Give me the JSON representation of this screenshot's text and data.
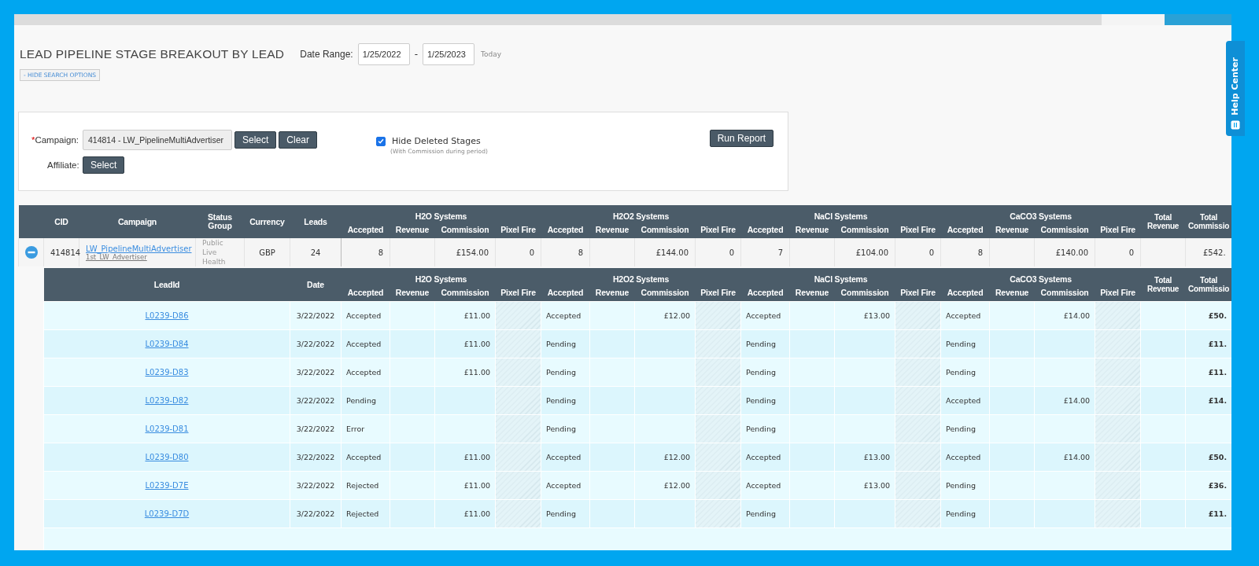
{
  "report": {
    "title": "LEAD PIPELINE STAGE BREAKOUT BY LEAD",
    "date_range_label": "Date Range:",
    "date_from": "1/25/2022",
    "separator": "-",
    "date_to": "1/25/2023",
    "today_link": "Today",
    "toggle_button": "- HIDE SEARCH OPTIONS"
  },
  "search": {
    "required_mark": "*",
    "campaign_label": "Campaign:",
    "campaign_value": "414814 - LW_PipelineMultiAdvertiser",
    "select_button": "Select",
    "clear_button": "Clear",
    "affiliate_label": "Affiliate:",
    "affiliate_select_button": "Select",
    "hide_deleted": {
      "label": "Hide Deleted Stages",
      "checked": true,
      "note": "(With Commission during period)"
    },
    "run_button": "Run Report"
  },
  "table": {
    "columns": [
      "CID",
      "Campaign",
      "Status Group",
      "Currency",
      "Leads"
    ],
    "systems": [
      {
        "name": "H2O Systems",
        "columns": [
          "Accepted",
          "Revenue",
          "Commission",
          "Pixel Fire"
        ]
      },
      {
        "name": "H2O2 Systems",
        "columns": [
          "Accepted",
          "Revenue",
          "Commission",
          "Pixel Fire"
        ]
      },
      {
        "name": "NaCl Systems",
        "columns": [
          "Accepted",
          "Revenue",
          "Commission",
          "Pixel Fire"
        ]
      },
      {
        "name": "CaCO3 Systems",
        "columns": [
          "Accepted",
          "Revenue",
          "Commission",
          "Pixel Fire"
        ]
      }
    ],
    "total_columns": [
      "Total Revenue",
      "Total Commissio"
    ],
    "rows": [
      {
        "expanded": true,
        "cid": "414814",
        "campaign": "LW_PipelineMultiAdvertiser",
        "advertiser": "1st_LW_Advertiser",
        "status_group": "Public Live Health",
        "currency": "GBP",
        "leads": "24",
        "systems": [
          {
            "accepted": "8",
            "commission": "£154.00",
            "pixel_fire": "0"
          },
          {
            "accepted": "8",
            "commission": "£144.00",
            "pixel_fire": "0"
          },
          {
            "accepted": "7",
            "commission": "£104.00",
            "pixel_fire": "0"
          },
          {
            "accepted": "8",
            "commission": "£140.00",
            "pixel_fire": "0"
          }
        ],
        "total_commission": "£542."
      }
    ]
  },
  "leads_table": {
    "columns": [
      "LeadId",
      "Date"
    ],
    "systems": [
      {
        "name": "H2O Systems",
        "columns": [
          "Accepted",
          "Revenue",
          "Commission",
          "Pixel Fire"
        ]
      },
      {
        "name": "H2O2 Systems",
        "columns": [
          "Accepted",
          "Revenue",
          "Commission",
          "Pixel Fire"
        ]
      },
      {
        "name": "NaCl Systems",
        "columns": [
          "Accepted",
          "Revenue",
          "Commission",
          "Pixel Fire"
        ]
      },
      {
        "name": "CaCO3 Systems",
        "columns": [
          "Accepted",
          "Revenue",
          "Commission",
          "Pixel Fire"
        ]
      }
    ],
    "total_columns": [
      "Total Revenue",
      "Total Commissio"
    ],
    "rows": [
      {
        "lead_id": "L0239-D86",
        "date": "3/22/2022",
        "systems": [
          {
            "status": "Accepted",
            "commission": "£11.00"
          },
          {
            "status": "Accepted",
            "commission": "£12.00"
          },
          {
            "status": "Accepted",
            "commission": "£13.00"
          },
          {
            "status": "Accepted",
            "commission": "£14.00"
          }
        ],
        "total_commission": "£50."
      },
      {
        "lead_id": "L0239-D84",
        "date": "3/22/2022",
        "systems": [
          {
            "status": "Accepted",
            "commission": "£11.00"
          },
          {
            "status": "Pending"
          },
          {
            "status": "Pending"
          },
          {
            "status": "Pending"
          }
        ],
        "total_commission": "£11."
      },
      {
        "lead_id": "L0239-D83",
        "date": "3/22/2022",
        "systems": [
          {
            "status": "Accepted",
            "commission": "£11.00"
          },
          {
            "status": "Pending"
          },
          {
            "status": "Pending"
          },
          {
            "status": "Pending"
          }
        ],
        "total_commission": "£11."
      },
      {
        "lead_id": "L0239-D82",
        "date": "3/22/2022",
        "systems": [
          {
            "status": "Pending"
          },
          {
            "status": "Pending"
          },
          {
            "status": "Pending"
          },
          {
            "status": "Accepted",
            "commission": "£14.00"
          }
        ],
        "total_commission": "£14."
      },
      {
        "lead_id": "L0239-D81",
        "date": "3/22/2022",
        "systems": [
          {
            "status": "Error"
          },
          {
            "status": "Pending"
          },
          {
            "status": "Pending"
          },
          {
            "status": "Pending"
          }
        ]
      },
      {
        "lead_id": "L0239-D80",
        "date": "3/22/2022",
        "systems": [
          {
            "status": "Accepted",
            "commission": "£11.00"
          },
          {
            "status": "Accepted",
            "commission": "£12.00"
          },
          {
            "status": "Accepted",
            "commission": "£13.00"
          },
          {
            "status": "Accepted",
            "commission": "£14.00"
          }
        ],
        "total_commission": "£50."
      },
      {
        "lead_id": "L0239-D7E",
        "date": "3/22/2022",
        "systems": [
          {
            "status": "Rejected",
            "commission": "£11.00"
          },
          {
            "status": "Accepted",
            "commission": "£12.00"
          },
          {
            "status": "Accepted",
            "commission": "£13.00"
          },
          {
            "status": "Pending"
          }
        ],
        "total_commission": "£36."
      },
      {
        "lead_id": "L0239-D7D",
        "date": "3/22/2022",
        "systems": [
          {
            "status": "Rejected",
            "commission": "£11.00"
          },
          {
            "status": "Pending"
          },
          {
            "status": "Pending"
          },
          {
            "status": "Pending"
          }
        ],
        "total_commission": "£11."
      }
    ]
  },
  "help_tab": {
    "label": "Help Center"
  }
}
